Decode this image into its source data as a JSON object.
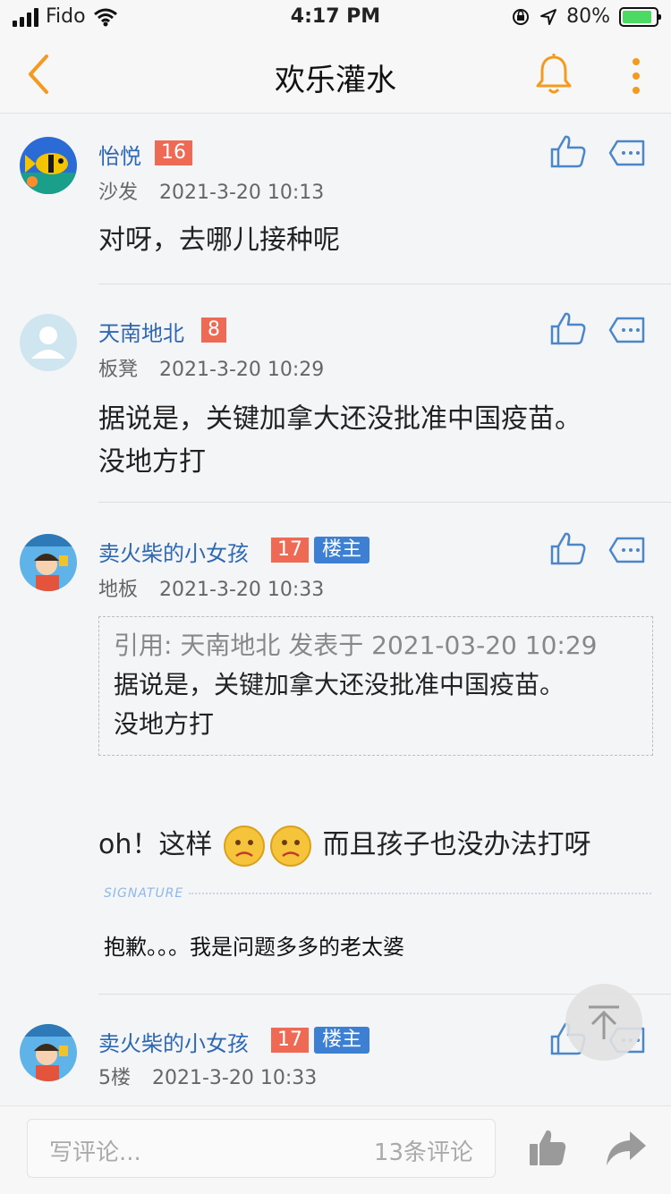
{
  "status_bar": {
    "carrier": "Fido",
    "time": "4:17 PM",
    "battery": "80%",
    "battery_level": 0.8,
    "icons": [
      "signal-icon",
      "wifi-icon",
      "orientation-lock-icon",
      "location-icon",
      "battery-icon"
    ]
  },
  "nav": {
    "title": "欢乐灌水",
    "icons": [
      "back-chevron-icon",
      "bell-icon",
      "more-vertical-icon"
    ],
    "accent_color": "#f39a1f"
  },
  "posts": [
    {
      "username": "怡悦",
      "level": "16",
      "floor": "沙发",
      "time": "2021-3-20 10:13",
      "content": "对呀，去哪儿接种呢"
    },
    {
      "username": "天南地北",
      "level": "8",
      "floor": "板凳",
      "time": "2021-3-20 10:29",
      "content_lines": [
        "据说是，关键加拿大还没批准中国疫苗。",
        "没地方打"
      ]
    },
    {
      "username": "卖火柴的小女孩",
      "level": "17",
      "badge": "楼主",
      "floor": "地板",
      "time": "2021-3-20 10:33",
      "quote": {
        "header": "引用: 天南地北 发表于 2021-03-20 10:29",
        "lines": [
          "据说是，关键加拿大还没批准中国疫苗。",
          "没地方打"
        ]
      },
      "content_before_emoji": "oh！这样",
      "content_after_emoji": "而且孩子也没办法打呀",
      "signature_label": "SIGNATURE",
      "signature": "抱歉。。。我是问题多多的老太婆"
    },
    {
      "username": "卖火柴的小女孩",
      "level": "17",
      "badge": "楼主",
      "floor": "5楼",
      "time": "2021-3-20 10:33"
    }
  ],
  "bottom_bar": {
    "placeholder": "写评论...",
    "comment_count": "13条评论",
    "icons": [
      "thumbs-up-icon",
      "share-arrow-icon"
    ]
  },
  "colors": {
    "username": "#2f68b2",
    "level_badge": "#ee6a55",
    "owner_badge": "#3d7fd2",
    "action_icon": "#4a86c8"
  }
}
